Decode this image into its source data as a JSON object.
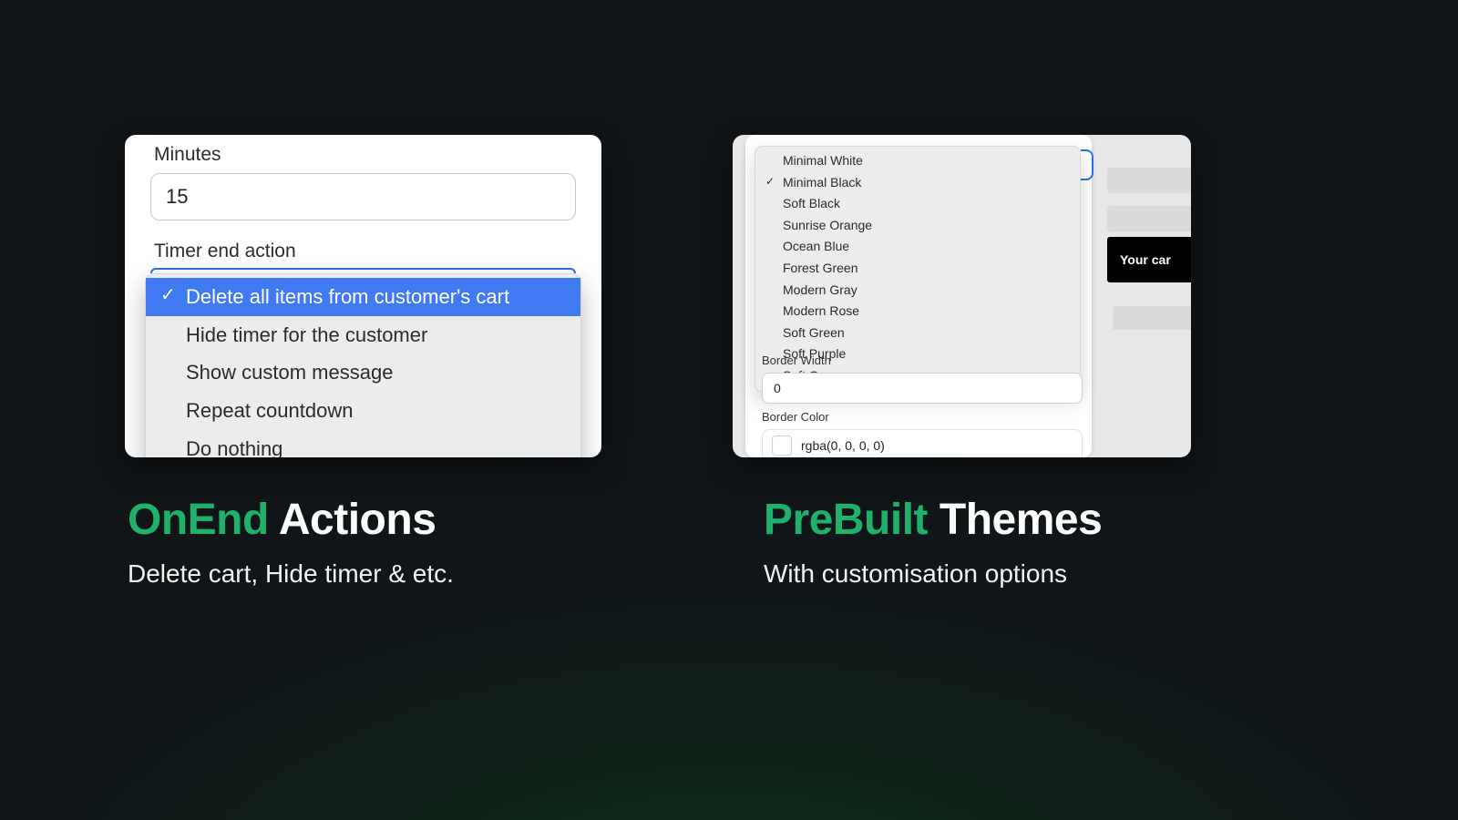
{
  "left_panel": {
    "minutes_label": "Minutes",
    "minutes_value": "15",
    "action_label": "Timer end action",
    "options": [
      "Delete all items from customer's cart",
      "Hide timer for the customer",
      "Show custom message",
      "Repeat countdown",
      "Do nothing"
    ],
    "selected_index": 0
  },
  "right_panel": {
    "themes": [
      "Minimal White",
      "Minimal Black",
      "Soft Black",
      "Sunrise Orange",
      "Ocean Blue",
      "Forest Green",
      "Modern Gray",
      "Modern Rose",
      "Soft Green",
      "Soft Purple",
      "Soft Orange"
    ],
    "selected_theme_index": 1,
    "border_width_label": "Border Width",
    "border_width_value": "0",
    "border_color_label": "Border Color",
    "border_color_value": "rgba(0, 0, 0, 0)",
    "preview_text": "Your car"
  },
  "headings": {
    "left_accent": "OnEnd",
    "left_white": " Actions",
    "left_sub": "Delete cart, Hide timer & etc.",
    "right_accent": "PreBuilt",
    "right_white": " Themes",
    "right_sub": "With customisation options"
  }
}
